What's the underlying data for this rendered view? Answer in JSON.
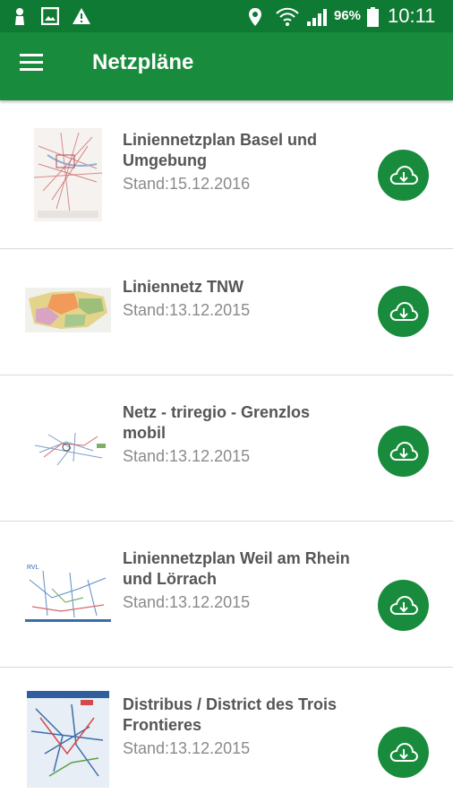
{
  "status_bar": {
    "battery_percent": "96%",
    "time": "10:11",
    "icons": [
      "notification-person-icon",
      "image-icon",
      "warning-icon",
      "location-icon",
      "wifi-icon",
      "signal-icon",
      "battery-icon"
    ]
  },
  "app_bar": {
    "title": "Netzpläne",
    "menu_icon": "hamburger-menu-icon"
  },
  "plans": [
    {
      "title": "Liniennetzplan Basel und Umgebung",
      "date": "Stand:15.12.2016"
    },
    {
      "title": "Liniennetz TNW",
      "date": "Stand:13.12.2015"
    },
    {
      "title": "Netz - triregio - Grenzlos mobil",
      "date": "Stand:13.12.2015"
    },
    {
      "title": "Liniennetzplan Weil am Rhein und Lörrach",
      "date": "Stand:13.12.2015"
    },
    {
      "title": "Distribus / District des Trois Frontieres",
      "date": "Stand:13.12.2015"
    }
  ],
  "colors": {
    "status_bar": "#0f7a33",
    "app_bar": "#188c3c",
    "download_button": "#188c3c"
  }
}
